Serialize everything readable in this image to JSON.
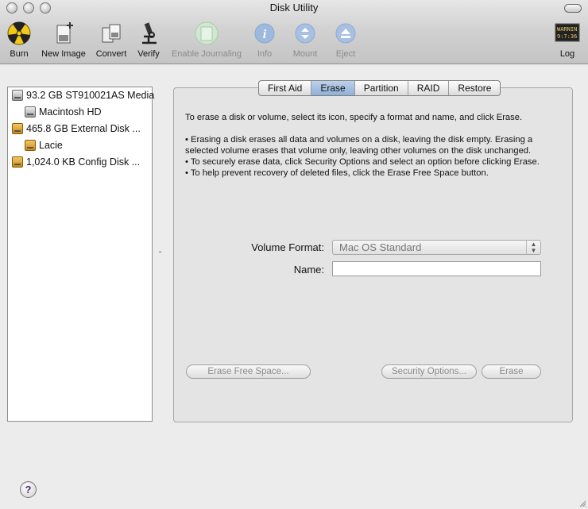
{
  "window": {
    "title": "Disk Utility"
  },
  "toolbar": {
    "items": [
      {
        "label": "Burn",
        "icon": "burn-icon",
        "enabled": true
      },
      {
        "label": "New Image",
        "icon": "new-image-icon",
        "enabled": true
      },
      {
        "label": "Convert",
        "icon": "convert-icon",
        "enabled": true
      },
      {
        "label": "Verify",
        "icon": "microscope-icon",
        "enabled": true
      },
      {
        "label": "Enable Journaling",
        "icon": "journal-icon",
        "enabled": false
      },
      {
        "label": "Info",
        "icon": "info-icon",
        "enabled": false
      },
      {
        "label": "Mount",
        "icon": "mount-icon",
        "enabled": false
      },
      {
        "label": "Eject",
        "icon": "eject-icon",
        "enabled": false
      },
      {
        "label": "Log",
        "icon": "log-icon",
        "enabled": true
      }
    ],
    "log_icon_text": [
      "WARNIN",
      "9:7:36 I"
    ]
  },
  "sidebar": {
    "items": [
      {
        "label": "93.2 GB ST910021AS Media",
        "type": "internal"
      },
      {
        "label": "Macintosh HD",
        "type": "internal"
      },
      {
        "label": "465.8 GB External Disk ...",
        "type": "external"
      },
      {
        "label": "Lacie",
        "type": "external"
      },
      {
        "label": "1,024.0 KB Config Disk ...",
        "type": "external"
      }
    ]
  },
  "tabs": [
    {
      "label": "First Aid",
      "active": false
    },
    {
      "label": "Erase",
      "active": true
    },
    {
      "label": "Partition",
      "active": false
    },
    {
      "label": "RAID",
      "active": false
    },
    {
      "label": "Restore",
      "active": false
    }
  ],
  "erase": {
    "intro": "To erase a disk or volume, select its icon, specify a format and name, and click Erase.",
    "bullets": [
      "• Erasing a disk erases all data and volumes on a disk, leaving the disk empty. Erasing a selected volume erases that volume only, leaving other volumes on the disk unchanged.",
      "• To securely erase data, click Security Options and select an option before clicking Erase.",
      "• To help prevent recovery of deleted files, click the Erase Free Space button."
    ],
    "volume_format_label": "Volume Format:",
    "volume_format_value": "Mac OS Standard",
    "name_label": "Name:",
    "name_value": "",
    "erase_free_space_label": "Erase Free Space...",
    "security_options_label": "Security Options...",
    "erase_label": "Erase"
  },
  "help": {
    "label": "?"
  },
  "colors": {
    "active_tab": "#9db9df",
    "panel": "#e4e4e4",
    "disabled_text": "#8a8a8a"
  }
}
